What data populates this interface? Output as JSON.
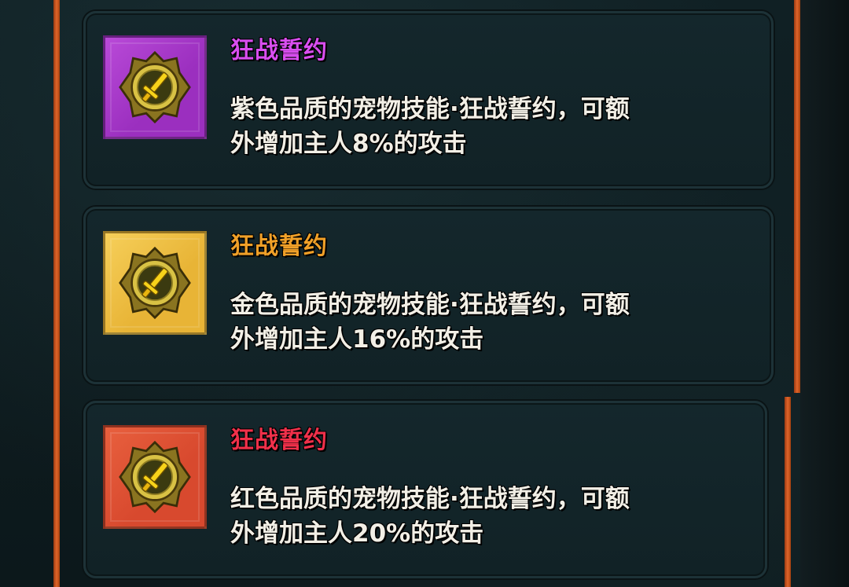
{
  "skills": [
    {
      "name": "狂战誓约",
      "name_color": "#d94ef0",
      "frame_color": "#9b2fbf",
      "frame_color_light": "#b94ad8",
      "icon": "sword-medallion-icon",
      "desc_line1": "紫色品质的宠物技能·狂战誓约，可额",
      "desc_line2": "外增加主人8%的攻击"
    },
    {
      "name": "狂战誓约",
      "name_color": "#f0a028",
      "frame_color": "#e8b436",
      "frame_color_light": "#f6cf5a",
      "icon": "sword-medallion-icon",
      "desc_line1": "金色品质的宠物技能·狂战誓约，可额",
      "desc_line2": "外增加主人16%的攻击"
    },
    {
      "name": "狂战誓约",
      "name_color": "#f0304a",
      "frame_color": "#d8492e",
      "frame_color_light": "#e8603e",
      "icon": "sword-medallion-icon",
      "desc_line1": "红色品质的宠物技能·狂战誓约，可额",
      "desc_line2": "外增加主人20%的攻击"
    }
  ]
}
